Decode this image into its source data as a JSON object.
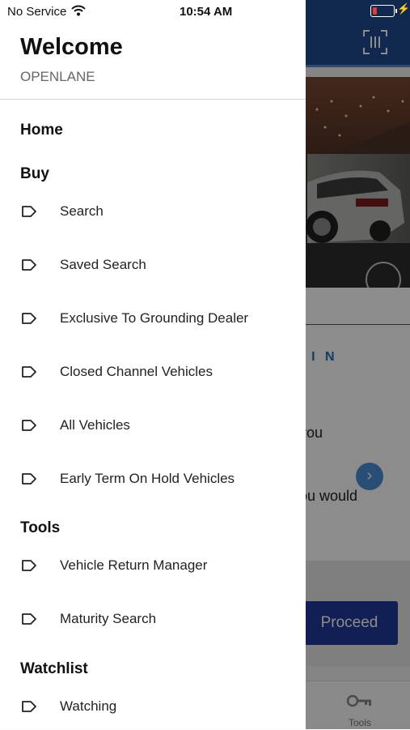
{
  "status_bar": {
    "carrier": "No Service",
    "time": "10:54 AM",
    "battery_level": 0.2,
    "battery_color": "#e53935"
  },
  "background": {
    "header_color": "#1f4c8f",
    "vin_label": "V I N",
    "text_line1": "you",
    "text_line2": "ou would",
    "proceed_label": "Proceed",
    "tabbar_tools_label": "Tools"
  },
  "drawer": {
    "title": "Welcome",
    "organization": "OPENLANE",
    "home_label": "Home",
    "sections": {
      "buy": {
        "title": "Buy",
        "items": [
          {
            "label": "Search",
            "icon": "tag-icon"
          },
          {
            "label": "Saved Search",
            "icon": "tag-icon"
          },
          {
            "label": "Exclusive To Grounding Dealer",
            "icon": "tag-icon"
          },
          {
            "label": "Closed Channel Vehicles",
            "icon": "tag-icon"
          },
          {
            "label": "All Vehicles",
            "icon": "tag-icon"
          },
          {
            "label": "Early Term On Hold Vehicles",
            "icon": "tag-icon"
          }
        ]
      },
      "tools": {
        "title": "Tools",
        "items": [
          {
            "label": "Vehicle Return Manager",
            "icon": "tag-icon"
          },
          {
            "label": "Maturity Search",
            "icon": "tag-icon"
          }
        ]
      },
      "watchlist": {
        "title": "Watchlist",
        "items": [
          {
            "label": "Watching",
            "icon": "tag-icon"
          }
        ]
      }
    }
  }
}
